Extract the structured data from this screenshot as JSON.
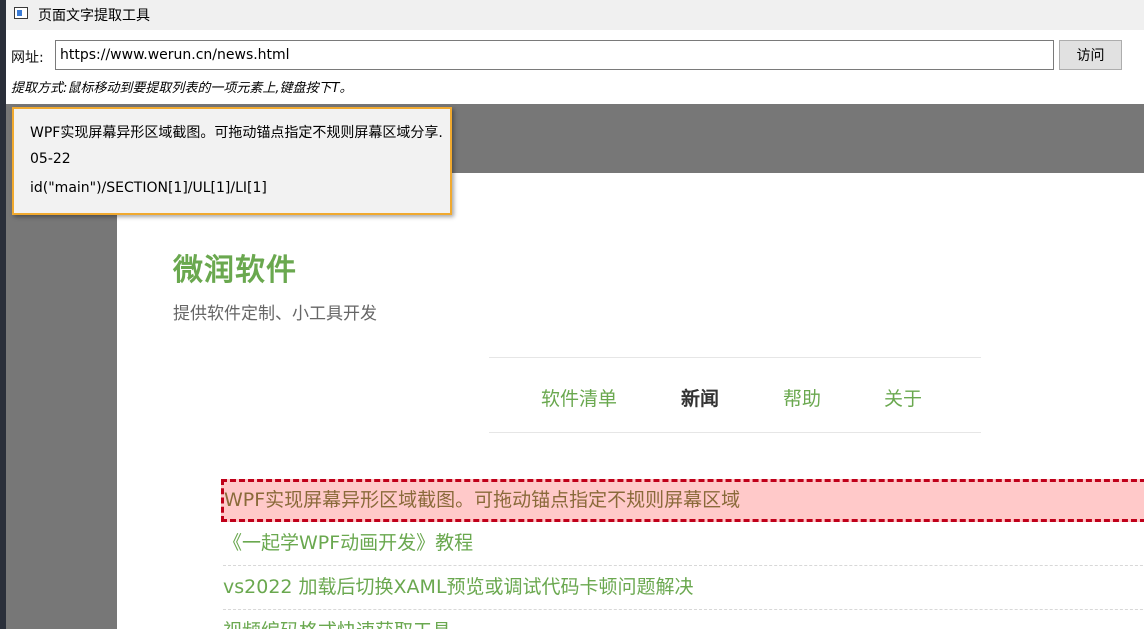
{
  "window": {
    "title": "页面文字提取工具"
  },
  "urlbar": {
    "label": "网址:",
    "url": "https://www.werun.cn/news.html",
    "visit_label": "访问"
  },
  "instructions": "提取方式:鼠标移动到要提取列表的一项元素上,键盘按下T。",
  "site": {
    "title": "微润软件",
    "subtitle": "提供软件定制、小工具开发",
    "nav": [
      {
        "label": "软件清单",
        "active": false
      },
      {
        "label": "新闻",
        "active": true
      },
      {
        "label": "帮助",
        "active": false
      },
      {
        "label": "关于",
        "active": false
      }
    ],
    "news": [
      "WPF实现屏幕异形区域截图。可拖动锚点指定不规则屏幕区域",
      "《一起学WPF动画开发》教程",
      "vs2022 加载后切换XAML预览或调试代码卡顿问题解决",
      "视频编码格式快速获取工具"
    ]
  },
  "tooltip": {
    "text": "WPF实现屏幕异形区域截图。可拖动锚点指定不规则屏幕区域分享. 05-22",
    "path": "id(\"main\")/SECTION[1]/UL[1]/LI[1]"
  },
  "colors": {
    "accent_green": "#6aa84f",
    "highlight_bg": "#ffc9c9",
    "highlight_border": "#c0001a",
    "tooltip_border": "#f0a92f"
  }
}
